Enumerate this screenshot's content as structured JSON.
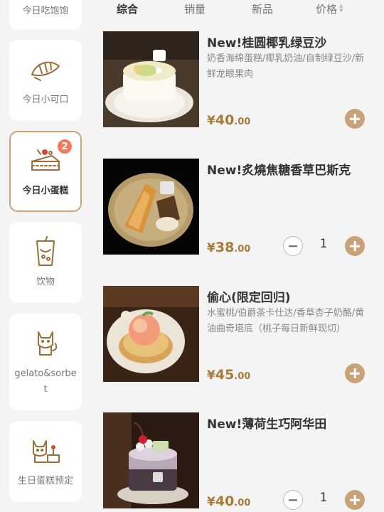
{
  "sidebar": {
    "items": [
      {
        "label": "今日吃饱饱",
        "icon": "cake-icon",
        "active": false
      },
      {
        "label": "今日小可口",
        "icon": "croissant-icon",
        "active": false
      },
      {
        "label": "今日小蛋糕",
        "icon": "cake-slice-icon",
        "active": true,
        "badge": "2"
      },
      {
        "label": "饮物",
        "icon": "drink-cup-icon",
        "active": false
      },
      {
        "label": "gelato&sorbet",
        "icon": "cat-icon",
        "active": false
      },
      {
        "label": "生日蛋糕预定",
        "icon": "birthday-cat-icon",
        "active": false
      }
    ]
  },
  "tabs": {
    "items": [
      {
        "label": "综合",
        "active": true
      },
      {
        "label": "销量",
        "active": false
      },
      {
        "label": "新品",
        "active": false
      },
      {
        "label": "价格",
        "active": false
      }
    ]
  },
  "products": [
    {
      "title": "New!桂圆椰乳绿豆沙",
      "description": "奶香海绵蛋糕/椰乳奶油/自制绿豆沙/新鲜龙眼果肉",
      "currency": "¥",
      "price_int": "40",
      "price_dec": ".00",
      "quantity": null
    },
    {
      "title": "New!炙燒焦糖香草巴斯克",
      "description": "",
      "currency": "¥",
      "price_int": "38",
      "price_dec": ".00",
      "quantity": "1"
    },
    {
      "title": "偷心(限定回归)",
      "description": "水蜜桃/伯爵茶卡仕达/香草杏子奶酪/黄油曲奇塔底（桃子每日新鲜现切）",
      "currency": "¥",
      "price_int": "45",
      "price_dec": ".00",
      "quantity": null
    },
    {
      "title": "New!薄荷生巧阿华田",
      "description": "",
      "currency": "¥",
      "price_int": "40",
      "price_dec": ".00",
      "quantity": "1"
    }
  ],
  "colors": {
    "accent": "#c8a37a",
    "price": "#a77b38",
    "badge": "#f07a5c"
  }
}
